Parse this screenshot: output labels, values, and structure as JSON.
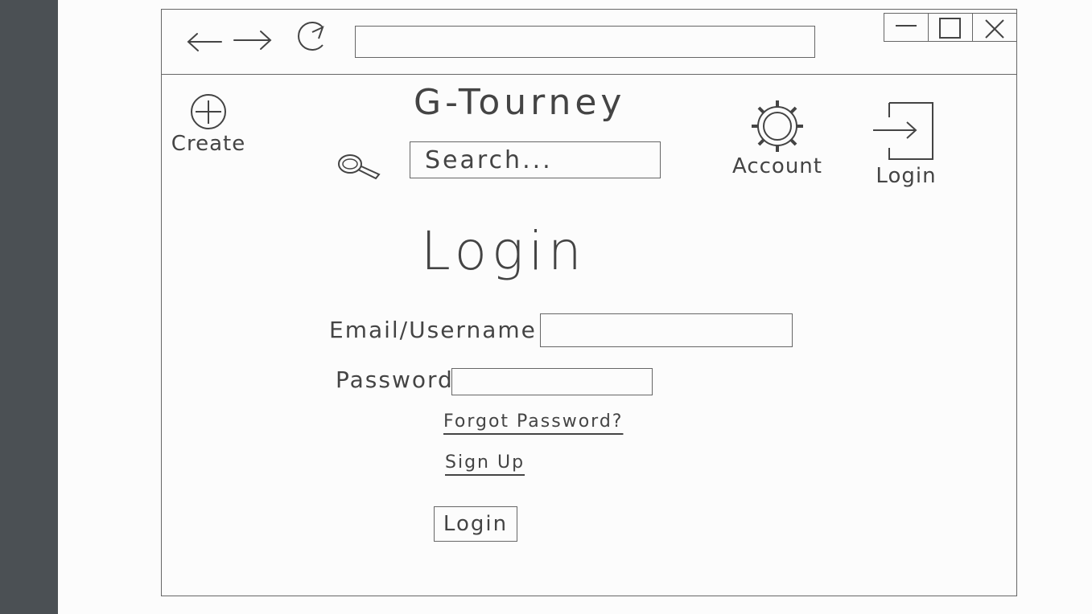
{
  "toolbar": {
    "create_label": "Create",
    "account_label": "Account",
    "login_label": "Login"
  },
  "app": {
    "title": "G-Tourney"
  },
  "search": {
    "placeholder": "Search..."
  },
  "form": {
    "title": "Login",
    "email_label": "Email/Username",
    "password_label": "Password",
    "forgot_link": "Forgot Password?",
    "signup_link": "Sign Up",
    "submit_label": "Login"
  },
  "icons": [
    "back-arrow-icon",
    "forward-arrow-icon",
    "refresh-icon",
    "minimize-icon",
    "maximize-icon",
    "close-icon",
    "plus-circle-icon",
    "search-icon",
    "gear-icon",
    "login-door-icon"
  ]
}
